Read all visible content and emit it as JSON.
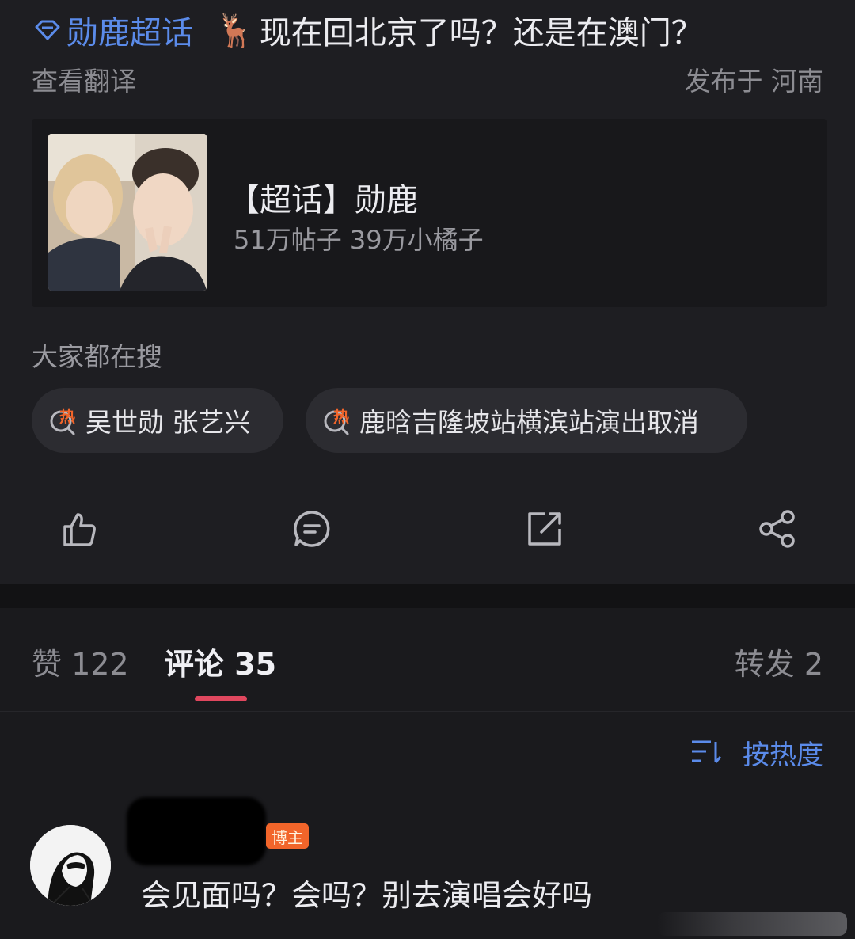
{
  "post": {
    "topic_link": "勋鹿超话",
    "title_emoji": "🦌",
    "title": "现在回北京了吗？还是在澳门？",
    "translate_label": "查看翻译",
    "location_label": "发布于 河南",
    "card": {
      "title": "【超话】勋鹿",
      "meta": "51万帖子 39万小橘子"
    },
    "search": {
      "title": "大家都在搜",
      "items": [
        {
          "label": "吴世勋 张艺兴",
          "badge": "热"
        },
        {
          "label": "鹿晗吉隆坡站横滨站演出取消",
          "badge": "热"
        }
      ]
    },
    "actions": [
      {
        "icon": "thumbs-up-icon"
      },
      {
        "icon": "comment-icon"
      },
      {
        "icon": "repost-icon"
      },
      {
        "icon": "share-icon"
      }
    ]
  },
  "tabs": {
    "likes": "赞 122",
    "comments": "评论 35",
    "reposts": "转发 2"
  },
  "sort_label": "按热度",
  "comment": {
    "badge": "博主",
    "text": "会见面吗？会吗？别去演唱会好吗"
  },
  "colors": {
    "background": "#1e1e22",
    "link": "#5b8bea",
    "indicator": "#e0475e",
    "hot_badge": "#f2652a"
  }
}
